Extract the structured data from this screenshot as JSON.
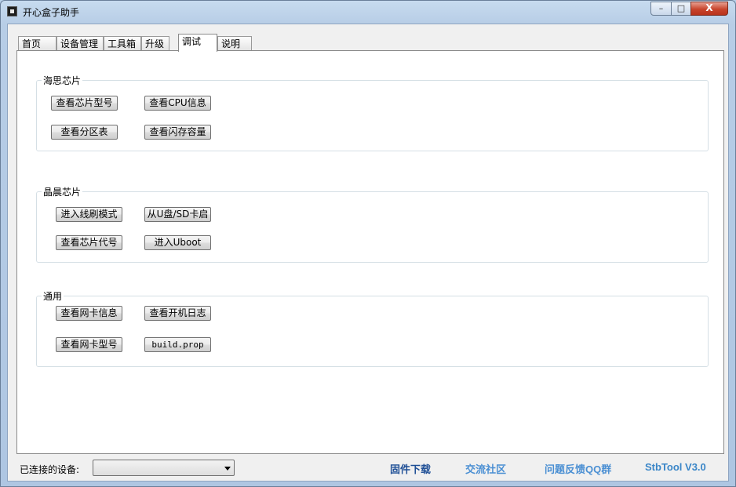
{
  "window": {
    "title": "开心盒子助手",
    "controls": {
      "minimize": "–",
      "maximize": "□",
      "close": "X"
    }
  },
  "tabs": [
    {
      "label": "首页"
    },
    {
      "label": "设备管理"
    },
    {
      "label": "工具箱"
    },
    {
      "label": "升级"
    },
    {
      "label": "调试",
      "active": true
    },
    {
      "label": "说明"
    }
  ],
  "groups": {
    "hisilicon": {
      "title": "海思芯片",
      "buttons": [
        "查看芯片型号",
        "查看CPU信息",
        "查看分区表",
        "查看闪存容量"
      ]
    },
    "amlogic": {
      "title": "晶晨芯片",
      "buttons": [
        "进入线刷模式",
        "从U盘/SD卡启",
        "查看芯片代号",
        "进入Uboot"
      ]
    },
    "general": {
      "title": "通用",
      "buttons": [
        "查看网卡信息",
        "查看开机日志",
        "查看网卡型号",
        "build.prop"
      ]
    }
  },
  "status": {
    "connected_label": "已连接的设备:",
    "device_value": ""
  },
  "links": {
    "firmware": "固件下载",
    "community": "交流社区",
    "feedback": "问题反馈QQ群",
    "version": "StbTool V3.0"
  },
  "colors": {
    "link_dark": "#1f4f96",
    "link_light": "#4a8fd3",
    "version": "#3a86c8"
  }
}
